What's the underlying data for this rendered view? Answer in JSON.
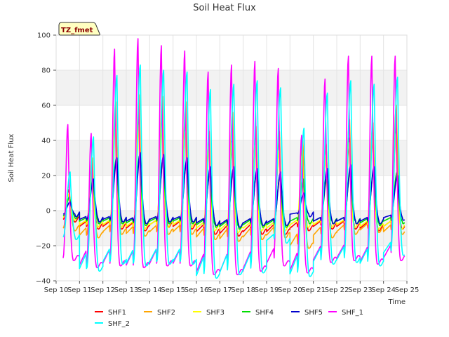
{
  "chart_data": {
    "type": "line",
    "title": "Soil Heat Flux",
    "xlabel": "Time",
    "ylabel": "Soil Heat Flux",
    "annotation": "TZ_fmet",
    "xlim": [
      10,
      25
    ],
    "ylim": [
      -40,
      100
    ],
    "x_ticks": [
      10,
      11,
      12,
      13,
      14,
      15,
      16,
      17,
      18,
      19,
      20,
      21,
      22,
      23,
      24,
      25
    ],
    "x_tick_labels": [
      "Sep 10",
      "Sep 11",
      "Sep 12",
      "Sep 13",
      "Sep 14",
      "Sep 15",
      "Sep 16",
      "Sep 17",
      "Sep 18",
      "Sep 19",
      "Sep 20",
      "Sep 21",
      "Sep 22",
      "Sep 23",
      "Sep 24",
      "Sep 25"
    ],
    "y_ticks": [
      -40,
      -20,
      0,
      20,
      40,
      60,
      80,
      100
    ],
    "y_tick_labels": [
      "−40",
      "−20",
      "0",
      "20",
      "40",
      "60",
      "80",
      "100"
    ],
    "grid": true,
    "legend_position": "bottom",
    "days": [
      10.3,
      11,
      12,
      13,
      14,
      15,
      16,
      17,
      18,
      19,
      20,
      21,
      22,
      23,
      24
    ],
    "series": [
      {
        "name": "SHF1",
        "color": "#ff0000",
        "peak_x": 0.55,
        "night": -2,
        "peaks": [
          12,
          25,
          55,
          58,
          55,
          52,
          40,
          40,
          45,
          42,
          38,
          37,
          42,
          45,
          48
        ],
        "troughs": [
          -5,
          -9,
          -9,
          -10,
          -8,
          -9,
          -12,
          -13,
          -12,
          -12,
          -10,
          -9,
          -9,
          -10,
          -9
        ]
      },
      {
        "name": "SHF2",
        "color": "#ffa500",
        "peak_x": 0.55,
        "night": -4,
        "peaks": [
          15,
          30,
          62,
          66,
          65,
          62,
          45,
          56,
          48,
          45,
          40,
          38,
          52,
          50,
          60
        ],
        "troughs": [
          -10,
          -14,
          -12,
          -13,
          -12,
          -12,
          -15,
          -16,
          -15,
          -14,
          -20,
          -14,
          -12,
          -11,
          -12
        ]
      },
      {
        "name": "SHF3",
        "color": "#ffff00",
        "peak_x": 0.52,
        "night": -2,
        "peaks": [
          10,
          22,
          48,
          50,
          48,
          46,
          38,
          40,
          38,
          35,
          32,
          32,
          40,
          45,
          45
        ],
        "troughs": [
          -4,
          -8,
          -8,
          -9,
          -8,
          -8,
          -10,
          -11,
          -10,
          -10,
          -8,
          -8,
          -8,
          -9,
          -9
        ]
      },
      {
        "name": "SHF4",
        "color": "#00dd00",
        "peak_x": 0.58,
        "night": -1,
        "peaks": [
          8,
          18,
          30,
          32,
          30,
          28,
          22,
          24,
          22,
          20,
          18,
          18,
          22,
          22,
          22
        ],
        "troughs": [
          -3,
          -6,
          -6,
          -7,
          -6,
          -6,
          -8,
          -9,
          -8,
          -8,
          -6,
          -6,
          -6,
          -7,
          -6
        ]
      },
      {
        "name": "SHF5",
        "color": "#0000cc",
        "peak_x": 0.6,
        "night": 0,
        "peaks": [
          5,
          18,
          30,
          33,
          32,
          30,
          25,
          25,
          24,
          22,
          10,
          24,
          26,
          25,
          20
        ],
        "troughs": [
          -2,
          -5,
          -5,
          -6,
          -5,
          -5,
          -7,
          -8,
          -7,
          -7,
          -2,
          -6,
          -6,
          -6,
          -4
        ]
      },
      {
        "name": "SHF_1",
        "color": "#ff00ff",
        "peak_x": 0.5,
        "night": -22,
        "peaks": [
          49,
          44,
          92,
          98,
          94,
          91,
          79,
          83,
          85,
          81,
          43,
          75,
          88,
          88,
          88
        ],
        "troughs": [
          -27,
          -31,
          -30,
          -31,
          -30,
          -30,
          -35,
          -35,
          -33,
          -30,
          -34,
          -28,
          -27,
          -29,
          -27
        ]
      },
      {
        "name": "SHF_2",
        "color": "#00ffff",
        "peak_x": 0.6,
        "night": -25,
        "peaks": [
          22,
          42,
          77,
          83,
          80,
          79,
          69,
          72,
          74,
          70,
          47,
          67,
          74,
          72,
          76
        ],
        "troughs": [
          -15,
          -33,
          -29,
          -30,
          -29,
          -29,
          -37,
          -35,
          -34,
          -17,
          -36,
          -29,
          -28,
          -30,
          -24
        ]
      }
    ]
  }
}
